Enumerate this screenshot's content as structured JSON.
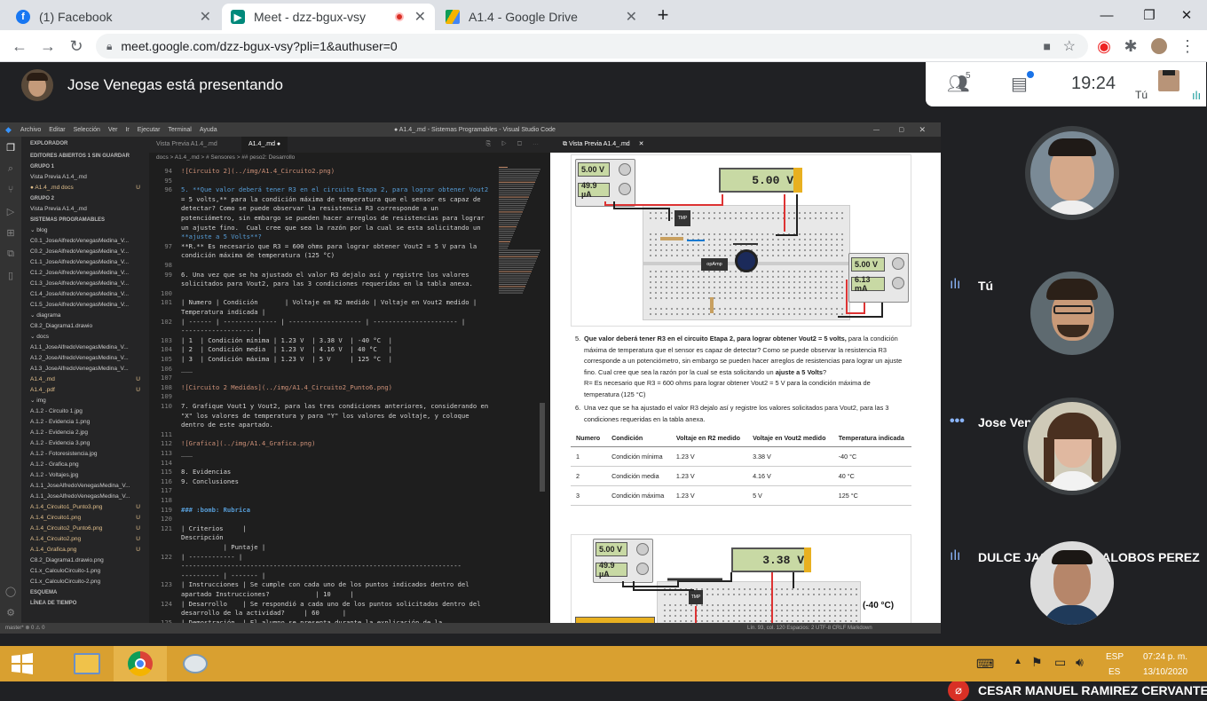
{
  "browser": {
    "tabs": [
      {
        "label": "(1) Facebook",
        "active": false
      },
      {
        "label": "Meet - dzz-bgux-vsy",
        "active": true
      },
      {
        "label": "A1.4 - Google Drive",
        "active": false
      }
    ],
    "url": "meet.google.com/dzz-bgux-vsy?pli=1&authuser=0"
  },
  "meet": {
    "presenting_label": "Jose Venegas está presentando",
    "participant_count": "5",
    "time": "19:24",
    "self_label": "Tú",
    "participants": [
      {
        "name": "Tú",
        "status": "speaking"
      },
      {
        "name": "Jose Venegas",
        "status": "dots"
      },
      {
        "name": "DULCE JASMIN VILLALOBOS PEREZ",
        "status": "speaking"
      },
      {
        "name": "CESAR MANUEL RAMIREZ CERVANTES",
        "status": "muted"
      }
    ]
  },
  "vscode": {
    "title": "● A1.4_.md - Sistemas Programables - Visual Studio Code",
    "menu": [
      "Archivo",
      "Editar",
      "Selección",
      "Ver",
      "Ir",
      "Ejecutar",
      "Terminal",
      "Ayuda"
    ],
    "explorer_title": "EXPLORADOR",
    "explorer": [
      {
        "t": "EDITORES ABIERTOS   1 SIN GUARDAR",
        "c": "hdr"
      },
      {
        "t": "GRUPO 1",
        "c": "hdr"
      },
      {
        "t": "   Vista Previa A1.4_.md",
        "c": ""
      },
      {
        "t": " ● A1.4_.md docs",
        "c": "orange",
        "u": "U"
      },
      {
        "t": "GRUPO 2",
        "c": "hdr"
      },
      {
        "t": "   Vista Previa A1.4_.md",
        "c": ""
      },
      {
        "t": "SISTEMAS PROGRAMABLES",
        "c": "hdr"
      },
      {
        "t": " ⌄ blog",
        "c": ""
      },
      {
        "t": "   C0.1_JoseAlfredoVenegasMedina_V...",
        "c": ""
      },
      {
        "t": "   C0.2_JoseAlfredoVenegasMedina_V...",
        "c": ""
      },
      {
        "t": "   C1.1_JoseAlfredoVenegasMedina_V...",
        "c": ""
      },
      {
        "t": "   C1.2_JoseAlfredoVenegasMedina_V...",
        "c": ""
      },
      {
        "t": "   C1.3_JoseAlfredoVenegasMedina_V...",
        "c": ""
      },
      {
        "t": "   C1.4_JoseAlfredoVenegasMedina_V...",
        "c": ""
      },
      {
        "t": "   C1.5_JoseAlfredoVenegasMedina_V...",
        "c": ""
      },
      {
        "t": " ⌄ diagrama",
        "c": ""
      },
      {
        "t": "   C8.2_Diagrama1.drawio",
        "c": ""
      },
      {
        "t": " ⌄ docs",
        "c": ""
      },
      {
        "t": "   A1.1_JoseAlfredoVenegasMedina_V...",
        "c": ""
      },
      {
        "t": "   A1.2_JoseAlfredoVenegasMedina_V...",
        "c": ""
      },
      {
        "t": "   A1.3_JoseAlfredoVenegasMedina_V...",
        "c": ""
      },
      {
        "t": "   A1.4_.md",
        "c": "orange",
        "u": "U"
      },
      {
        "t": "   A1.4_.pdf",
        "c": "orange",
        "u": "U"
      },
      {
        "t": " ⌄ img",
        "c": ""
      },
      {
        "t": "   A.1.2 - Circuito 1.jpg",
        "c": ""
      },
      {
        "t": "   A.1.2 - Evidencia 1.png",
        "c": ""
      },
      {
        "t": "   A.1.2 - Evidencia 2.jpg",
        "c": ""
      },
      {
        "t": "   A.1.2 - Evidencia 3.png",
        "c": ""
      },
      {
        "t": "   A.1.2 - Fotoresistencia.jpg",
        "c": ""
      },
      {
        "t": "   A.1.2 - Grafica.png",
        "c": ""
      },
      {
        "t": "   A.1.2 - Voltajes.jpg",
        "c": ""
      },
      {
        "t": "   A.1.1_JoseAlfredoVenegasMedina_V...",
        "c": ""
      },
      {
        "t": "   A.1.1_JoseAlfredoVenegasMedina_V...",
        "c": ""
      },
      {
        "t": "   A.1.4_Circuito1_Punto3.png",
        "c": "orange",
        "u": "U"
      },
      {
        "t": "   A.1.4_Circuito1.png",
        "c": "orange",
        "u": "U"
      },
      {
        "t": "   A.1.4_Circuito2_Punto6.png",
        "c": "orange",
        "u": "U"
      },
      {
        "t": "   A.1.4_Circuito2.png",
        "c": "orange",
        "u": "U"
      },
      {
        "t": "   A.1.4_Grafica.png",
        "c": "orange",
        "u": "U"
      },
      {
        "t": "   C8.2_Diagrama1.drawio.png",
        "c": ""
      },
      {
        "t": "   C1.x_CalculoCircuito-1.png",
        "c": ""
      },
      {
        "t": "   C1.x_CalculoCircuito-2.png",
        "c": ""
      },
      {
        "t": "ESQUEMA",
        "c": "hdr"
      },
      {
        "t": "LÍNEA DE TIEMPO",
        "c": "hdr"
      }
    ],
    "editor_tabs": [
      "Vista Previa A1.4_.md",
      "A1.4_.md ●"
    ],
    "breadcrumb": "docs > A1.4_.md > # Sensores > ## peso2: Desarrollo",
    "code": [
      {
        "n": "94",
        "t": "![Circuito 2](../img/A1.4_Circuito2.png)",
        "c": "md"
      },
      {
        "n": "95",
        "t": "",
        "c": ""
      },
      {
        "n": "96",
        "t": "5. **Que valor deberá tener R3 en el circuito Etapa 2, para lograr obtener Vout2",
        "c": "bold"
      },
      {
        "n": "",
        "t": "= 5 volts,** para la condición máxima de temperatura que el sensor es capaz de",
        "c": ""
      },
      {
        "n": "",
        "t": "detectar? Como se puede observar la resistencia R3 corresponde a un",
        "c": ""
      },
      {
        "n": "",
        "t": "potenciómetro, sin embargo se pueden hacer arreglos de resistencias para lograr",
        "c": ""
      },
      {
        "n": "",
        "t": "un ajuste fino.  Cual cree que sea la razón por la cual se esta solicitando un",
        "c": ""
      },
      {
        "n": "",
        "t": "**ajuste a 5 Volts**?",
        "c": "bold"
      },
      {
        "n": "97",
        "t": "**R.** Es necesario que R3 = 600 ohms para lograr obtener Vout2 = 5 V para la",
        "c": ""
      },
      {
        "n": "",
        "t": "condición máxima de temperatura (125 °C)",
        "c": ""
      },
      {
        "n": "98",
        "t": "",
        "c": ""
      },
      {
        "n": "99",
        "t": "6. Una vez que se ha ajustado el valor R3 dejalo así y registre los valores",
        "c": ""
      },
      {
        "n": "",
        "t": "solicitados para Vout2, para las 3 condiciones requeridas en la tabla anexa.",
        "c": ""
      },
      {
        "n": "100",
        "t": "",
        "c": ""
      },
      {
        "n": "101",
        "t": "| Numero | Condición       | Voltaje en R2 medido | Voltaje en Vout2 medido |",
        "c": ""
      },
      {
        "n": "",
        "t": "Temperatura indicada |",
        "c": ""
      },
      {
        "n": "102",
        "t": "| ------ | -------------- | ------------------- | ---------------------- |",
        "c": ""
      },
      {
        "n": "",
        "t": "------------------- |",
        "c": ""
      },
      {
        "n": "103",
        "t": "| 1  | Condición mínima | 1.23 V  | 3.38 V  | -40 °C  |",
        "c": ""
      },
      {
        "n": "104",
        "t": "| 2  | Condición media  | 1.23 V  | 4.16 V  | 40 °C   |",
        "c": ""
      },
      {
        "n": "105",
        "t": "| 3  | Condición máxima | 1.23 V  | 5 V     | 125 °C  |",
        "c": ""
      },
      {
        "n": "106",
        "t": "___",
        "c": ""
      },
      {
        "n": "107",
        "t": "",
        "c": ""
      },
      {
        "n": "108",
        "t": "![Circuito 2 Medidas](../img/A1.4_Circuito2_Punto6.png)",
        "c": "md"
      },
      {
        "n": "109",
        "t": "",
        "c": ""
      },
      {
        "n": "110",
        "t": "7. Grafique Vout1 y Vout2, para las tres condiciones anteriores, considerando en",
        "c": ""
      },
      {
        "n": "",
        "t": "\"X\" los valores de temperatura y para \"Y\" los valores de voltaje, y coloque",
        "c": ""
      },
      {
        "n": "",
        "t": "dentro de este apartado.",
        "c": ""
      },
      {
        "n": "111",
        "t": "",
        "c": ""
      },
      {
        "n": "112",
        "t": "![Grafica](../img/A1.4_Grafica.png)",
        "c": "md"
      },
      {
        "n": "113",
        "t": "___",
        "c": ""
      },
      {
        "n": "114",
        "t": "",
        "c": ""
      },
      {
        "n": "115",
        "t": "8. Evidencias",
        "c": ""
      },
      {
        "n": "116",
        "t": "9. Conclusiones",
        "c": ""
      },
      {
        "n": "117",
        "t": "",
        "c": ""
      },
      {
        "n": "118",
        "t": "",
        "c": ""
      },
      {
        "n": "119",
        "t": "### :bomb: Rubrica",
        "c": "h"
      },
      {
        "n": "120",
        "t": "",
        "c": ""
      },
      {
        "n": "121",
        "t": "| Criterios     |",
        "c": ""
      },
      {
        "n": "",
        "t": "Descripción",
        "c": ""
      },
      {
        "n": "",
        "t": "           | Puntaje |",
        "c": ""
      },
      {
        "n": "122",
        "t": "| ------------ |",
        "c": ""
      },
      {
        "n": "",
        "t": "-------------------------------------------------------------------------",
        "c": ""
      },
      {
        "n": "",
        "t": "---------- | ------- |",
        "c": ""
      },
      {
        "n": "123",
        "t": "| Instrucciones | Se cumple con cada uno de los puntos indicados dentro del",
        "c": ""
      },
      {
        "n": "",
        "t": "apartado Instrucciones?            | 10     |",
        "c": ""
      },
      {
        "n": "124",
        "t": "| Desarrollo    | Se respondió a cada uno de los puntos solicitados dentro del",
        "c": ""
      },
      {
        "n": "",
        "t": "desarrollo de la actividad?     | 60      |",
        "c": ""
      },
      {
        "n": "125",
        "t": "| Demostración  | El alumno se presenta durante la explicación de la",
        "c": ""
      }
    ],
    "preview_tab": "Vista Previa A1.4_.md",
    "status_left": "master*   ⊗ 0 ⚠ 0",
    "status_right": "Lín. 93, col. 120   Espacios: 2   UTF-8   CRLF   Markdown"
  },
  "preview": {
    "circuit1": {
      "main_lcd": "5.00 V",
      "m1": "5.00 V",
      "m2": "49.9 µA",
      "m3": "5.00 V",
      "m4": "6.13 mA",
      "chip1": "TMP",
      "chip2": "opAmp"
    },
    "q5_number": "5.",
    "q5_bold": "Que valor deberá tener R3 en el circuito Etapa 2, para lograr obtener Vout2 = 5 volts,",
    "q5_rest": " para la condición máxima de temperatura que el sensor es capaz de detectar? Como se puede observar la resistencia R3 corresponde a un potenciómetro, sin embargo se pueden hacer arreglos de resistencias para lograr un ajuste fino. Cual cree que sea la razón por la cual se esta solicitando un ",
    "q5_bold2": "ajuste a 5 Volts",
    "q5_end": "?",
    "q5_answer": "R= Es necesario que R3 = 600 ohms para lograr obtener Vout2 = 5 V para la condición máxima de temperatura (125 °C)",
    "q6_number": "6.",
    "q6_text": "Una vez que se ha ajustado el valor R3 dejalo así y registre los valores solicitados para Vout2, para las 3 condiciones requeridas en la tabla anexa.",
    "table_headers": [
      "Numero",
      "Condición",
      "Voltaje en R2 medido",
      "Voltaje en Vout2 medido",
      "Temperatura indicada"
    ],
    "table_rows": [
      [
        "1",
        "Condición mínima",
        "1.23 V",
        "3.38 V",
        "-40 °C"
      ],
      [
        "2",
        "Condición media",
        "1.23 V",
        "4.16 V",
        "40 °C"
      ],
      [
        "3",
        "Condición máxima",
        "1.23 V",
        "5 V",
        "125 °C"
      ]
    ],
    "circuit2": {
      "main_lcd": "3.38 V",
      "m1": "5.00 V",
      "m2": "49.9 µA",
      "temp": "(-40 °C)",
      "chip": "TMP"
    }
  },
  "taskbar": {
    "lang1": "ESP",
    "lang2": "ES",
    "time": "07:24 p. m.",
    "date": "13/10/2020"
  },
  "colors": {
    "meet_bg": "#202124",
    "taskbar": "#d9a030",
    "accent": "#1a73e8"
  }
}
